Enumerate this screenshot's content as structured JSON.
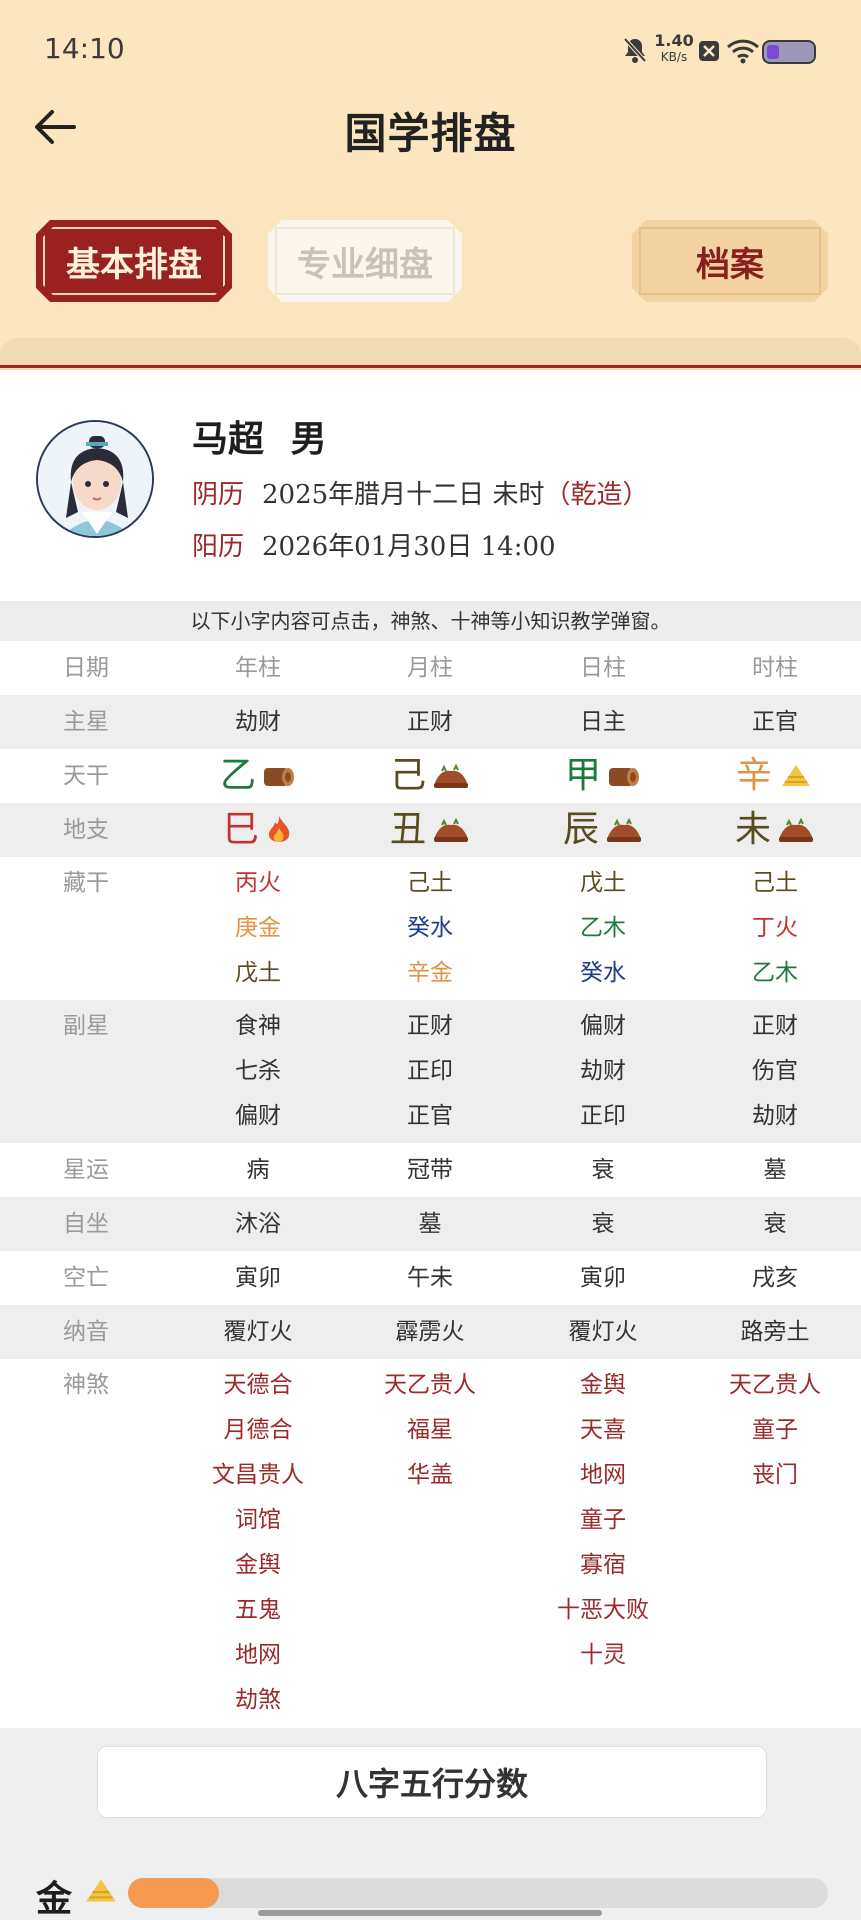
{
  "status_bar": {
    "time": "14:10",
    "net_speed": "1.40",
    "net_unit": "KB/s",
    "icons": [
      "mute-bell-icon",
      "close-box-icon",
      "wifi-icon",
      "battery-icon"
    ]
  },
  "header": {
    "title": "国学排盘",
    "tabs": [
      {
        "label": "基本排盘",
        "active": true
      },
      {
        "label": "专业细盘",
        "active": false
      },
      {
        "label": "档案",
        "active": false
      }
    ]
  },
  "profile": {
    "name": "马超",
    "gender": "男",
    "lunar_label": "阴历",
    "lunar_date": "2025年腊月十二日 未时",
    "lunar_tag": "（乾造）",
    "solar_label": "阳历",
    "solar_date": "2026年01月30日 14:00"
  },
  "notice": "以下小字内容可点击，神煞、十神等小知识教学弹窗。",
  "table": {
    "header": [
      "日期",
      "年柱",
      "月柱",
      "日柱",
      "时柱"
    ],
    "main_star": {
      "label": "主星",
      "values": [
        "劫财",
        "正财",
        "日主",
        "正官"
      ]
    },
    "tiangan": {
      "label": "天干",
      "values": [
        "乙",
        "己",
        "甲",
        "辛"
      ],
      "elements": [
        "wood",
        "earth",
        "wood",
        "metal"
      ]
    },
    "dizhi": {
      "label": "地支",
      "values": [
        "巳",
        "丑",
        "辰",
        "未"
      ],
      "elements": [
        "fire",
        "earth",
        "earth",
        "earth"
      ]
    },
    "canggan": {
      "label": "藏干",
      "values": [
        [
          "丙火",
          "庚金",
          "戊土"
        ],
        [
          "己土",
          "癸水",
          "辛金"
        ],
        [
          "戊土",
          "乙木",
          "癸水"
        ],
        [
          "己土",
          "丁火",
          "乙木"
        ]
      ]
    },
    "fuxing": {
      "label": "副星",
      "values": [
        [
          "食神",
          "七杀",
          "偏财"
        ],
        [
          "正财",
          "正印",
          "正官"
        ],
        [
          "偏财",
          "劫财",
          "正印"
        ],
        [
          "正财",
          "伤官",
          "劫财"
        ]
      ]
    },
    "xingyun": {
      "label": "星运",
      "values": [
        "病",
        "冠带",
        "衰",
        "墓"
      ]
    },
    "zizuo": {
      "label": "自坐",
      "values": [
        "沐浴",
        "墓",
        "衰",
        "衰"
      ]
    },
    "kongwang": {
      "label": "空亡",
      "values": [
        "寅卯",
        "午未",
        "寅卯",
        "戌亥"
      ]
    },
    "nayin": {
      "label": "纳音",
      "values": [
        "覆灯火",
        "霹雳火",
        "覆灯火",
        "路旁土"
      ]
    },
    "shensha": {
      "label": "神煞",
      "values": [
        [
          "天德合",
          "月德合",
          "文昌贵人",
          "词馆",
          "金舆",
          "五鬼",
          "地网",
          "劫煞"
        ],
        [
          "天乙贵人",
          "福星",
          "华盖"
        ],
        [
          "金舆",
          "天喜",
          "地网",
          "童子",
          "寡宿",
          "十恶大败",
          "十灵"
        ],
        [
          "天乙贵人",
          "童子",
          "丧门"
        ]
      ]
    }
  },
  "scores": {
    "button_label": "八字五行分数",
    "first_label": "金",
    "first_fraction": 0.13
  },
  "colors": {
    "header_bg": "#fbe6c0",
    "accent_red": "#9b2120",
    "fire": "#c23434",
    "metal": "#e0944a",
    "wood": "#1e7a3c",
    "water": "#1f3c8a",
    "earth": "#5a4a20",
    "bar": "#f49a52"
  }
}
